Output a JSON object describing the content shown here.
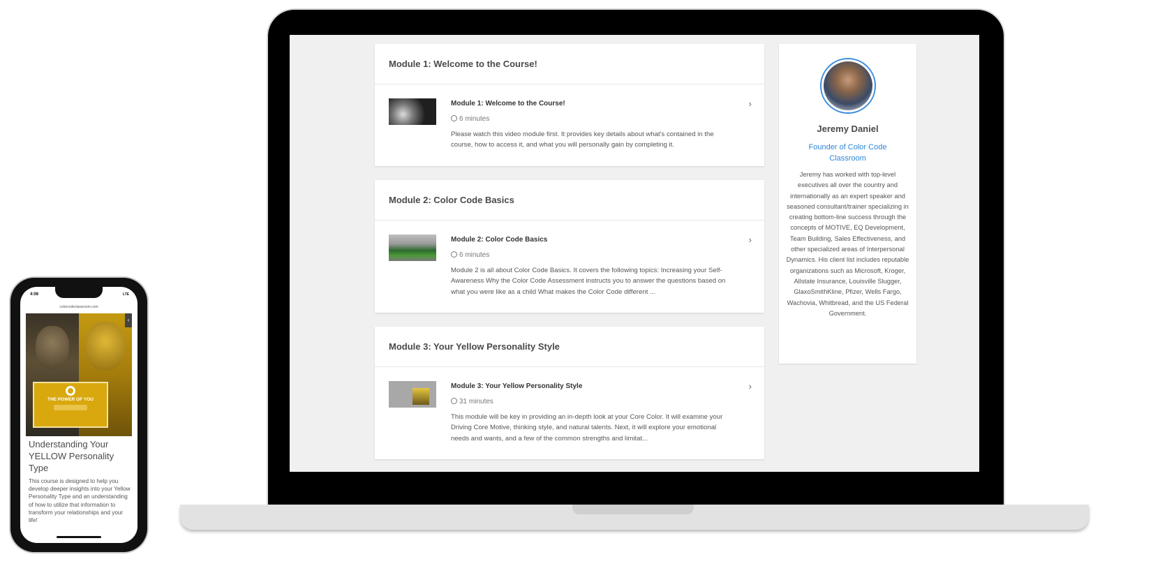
{
  "phone": {
    "time": "4:08",
    "status_icons": "LTE",
    "url": "colorcodeclassroom.com",
    "collapse_glyph": "‹",
    "hero_text": "THE POWER OF YOU",
    "course_title": "Understanding Your YELLOW Personality Type",
    "course_description": "This course is designed to help you develop deeper insights into your Yellow Personality Type and an understanding of how to utilize that information to transform your relationships and your life!"
  },
  "modules": [
    {
      "header": "Module 1: Welcome to the Course!",
      "lesson_title": "Module 1: Welcome to the Course!",
      "duration": "6 minutes",
      "description": "Please watch this video module first. It provides key details about what's contained in the course, how to access it, and what you will personally gain by completing it."
    },
    {
      "header": "Module 2: Color Code Basics",
      "lesson_title": "Module 2: Color Code Basics",
      "duration": "6 minutes",
      "description": "Module 2 is all about Color Code Basics. It covers the following topics: Increasing your Self-Awareness Why the Color Code Assessment instructs you to answer the questions based on what you were like as a child What makes the Color Code different ..."
    },
    {
      "header": "Module 3: Your Yellow Personality Style",
      "lesson_title": "Module 3: Your Yellow Personality Style",
      "duration": "31 minutes",
      "description": "This module will be key in providing an in-depth look at your Core Color. It will examine your Driving Core Motive, thinking style, and natural talents. Next, it will explore your emotional needs and wants, and a few of the common strengths and limitat..."
    }
  ],
  "arrow_glyph": "›",
  "author": {
    "name": "Jeremy Daniel",
    "role": "Founder of Color Code Classroom",
    "bio": "Jeremy has worked with top-level executives all over the country and internationally as an expert speaker and seasoned consultant/trainer specializing in creating bottom-line success through the concepts of MOTIVE, EQ Development, Team Building, Sales Effectiveness, and other specialized areas of Interpersonal Dynamics. His client list includes reputable organizations such as Microsoft, Kroger, Allstate Insurance, Louisville Slugger, GlaxoSmithKline, Pfizer, Wells Fargo, Wachovia, Whitbread, and the US Federal Government."
  },
  "colors": {
    "accent_link": "#2c86d8",
    "screen_background": "#f0f0f0",
    "hero_yellow": "#d9a80f"
  },
  "icons": {
    "lesson_duration": "clock-icon",
    "lesson_open": "chevron-right-icon",
    "phone_sidebar_toggle": "chevron-left-icon"
  }
}
